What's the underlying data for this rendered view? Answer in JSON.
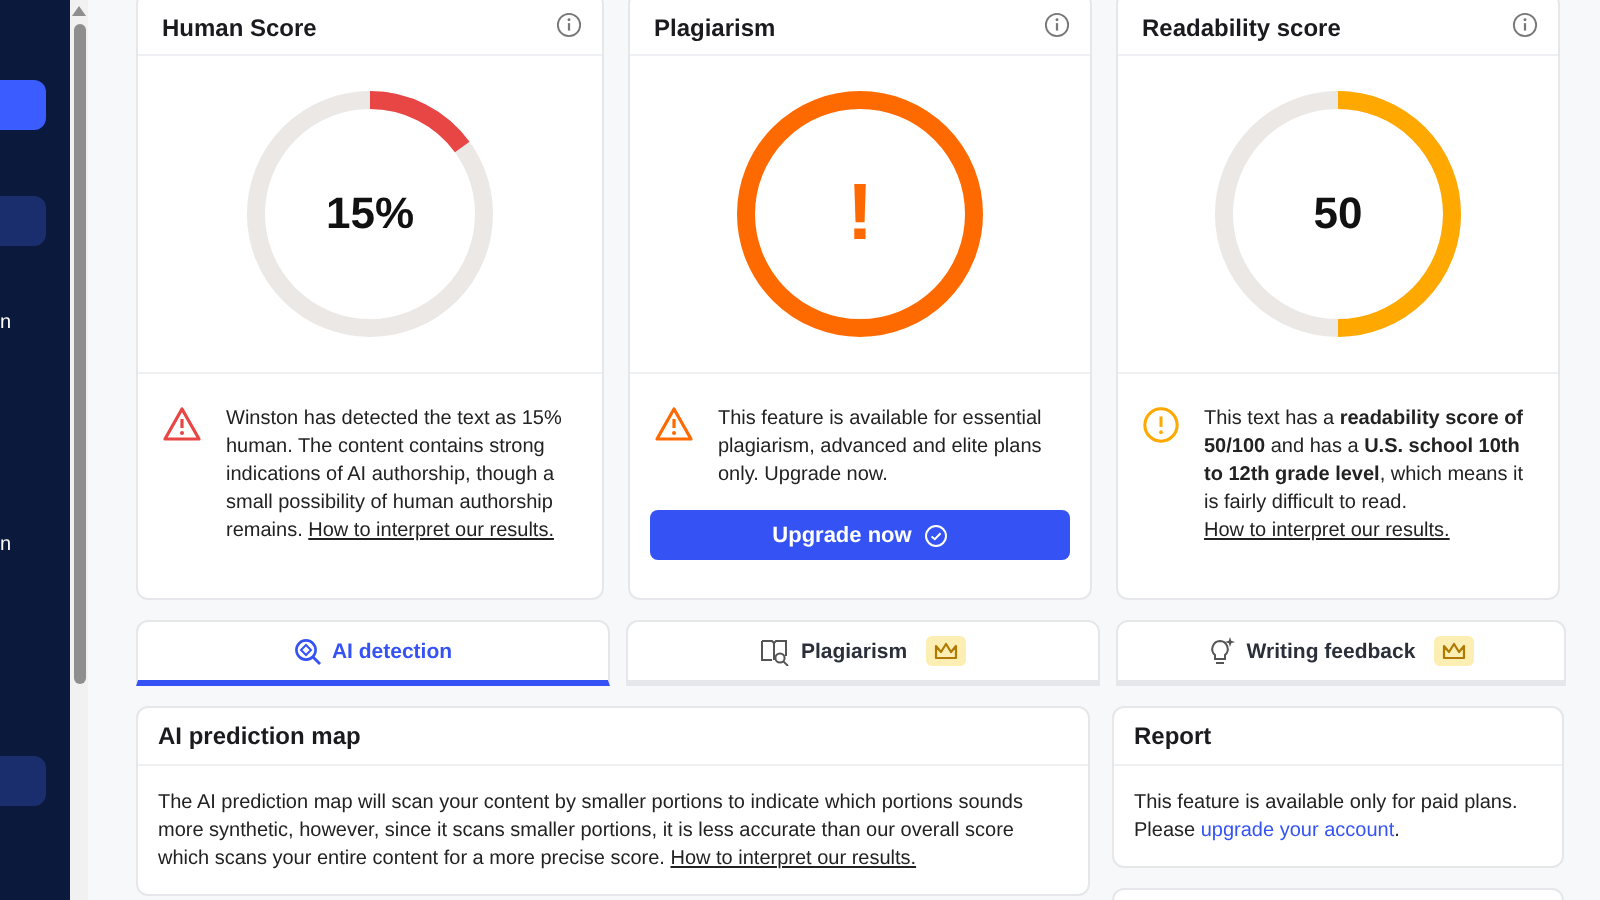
{
  "sidebar": {
    "items": [
      {
        "kind": "button",
        "selected": true
      },
      {
        "kind": "button",
        "selected": false
      },
      {
        "kind": "text",
        "label": "n"
      },
      {
        "kind": "text",
        "label": "n"
      },
      {
        "kind": "button",
        "selected": false
      }
    ]
  },
  "score_cards": [
    {
      "title": "Human Score",
      "kind": "score",
      "value": "15%",
      "color": "#e84545",
      "notice": {
        "kind": "warning",
        "text": "Winston has detected the text as 15% human. The content contains strong indications of AI authorship, though a small possibility of human authorship remains.",
        "link": "How to interpret our results."
      }
    },
    {
      "title": "Plagiarism",
      "kind": "locked",
      "value": "!",
      "color": "#ff6a00",
      "notice": {
        "kind": "warning",
        "text": "This feature is available for essential plagiarism, advanced and elite plans only. Upgrade now."
      },
      "button": "Upgrade now"
    },
    {
      "title": "Readability score",
      "kind": "score",
      "value": "50",
      "color": "#ffa800",
      "notice": {
        "kind": "info",
        "text": "This text has a **readability score of 50/100** and has a **U.S. school 10th to 12th grade level**, which means it is fairly difficult to read.",
        "link": "How to interpret our results."
      }
    }
  ],
  "tabs": [
    {
      "label": "AI detection",
      "selected": true,
      "premium": false
    },
    {
      "label": "Plagiarism",
      "selected": false,
      "premium": true
    },
    {
      "label": "Writing feedback",
      "selected": false,
      "premium": true
    }
  ],
  "prediction_map": {
    "title": "AI prediction map",
    "text": "The AI prediction map will scan your content by smaller portions to indicate which portions sounds more synthetic, however, since it scans smaller portions, it is less accurate than our overall score which scans your entire content for a more precise score.",
    "link": "How to interpret our results."
  },
  "report": {
    "title": "Report",
    "text": "This feature is available only for paid plans. Please",
    "link": "upgrade your account",
    "text_after": "."
  }
}
